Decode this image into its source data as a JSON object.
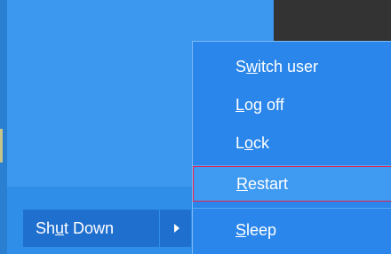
{
  "shutdown": {
    "label_prefix": "Sh",
    "label_underlined": "u",
    "label_suffix": "t Down"
  },
  "menu": {
    "items": [
      {
        "prefix": "S",
        "underlined": "w",
        "suffix": "itch user"
      },
      {
        "prefix": "",
        "underlined": "L",
        "suffix": "og off"
      },
      {
        "prefix": "L",
        "underlined": "o",
        "suffix": "ck"
      },
      {
        "prefix": "",
        "underlined": "R",
        "suffix": "estart"
      },
      {
        "prefix": "",
        "underlined": "S",
        "suffix": "leep"
      }
    ],
    "highlighted_index": 3
  },
  "colors": {
    "menu_bg": "#2a86ea",
    "button_bg": "#1f6fcf",
    "highlight_border": "#e0244f"
  }
}
